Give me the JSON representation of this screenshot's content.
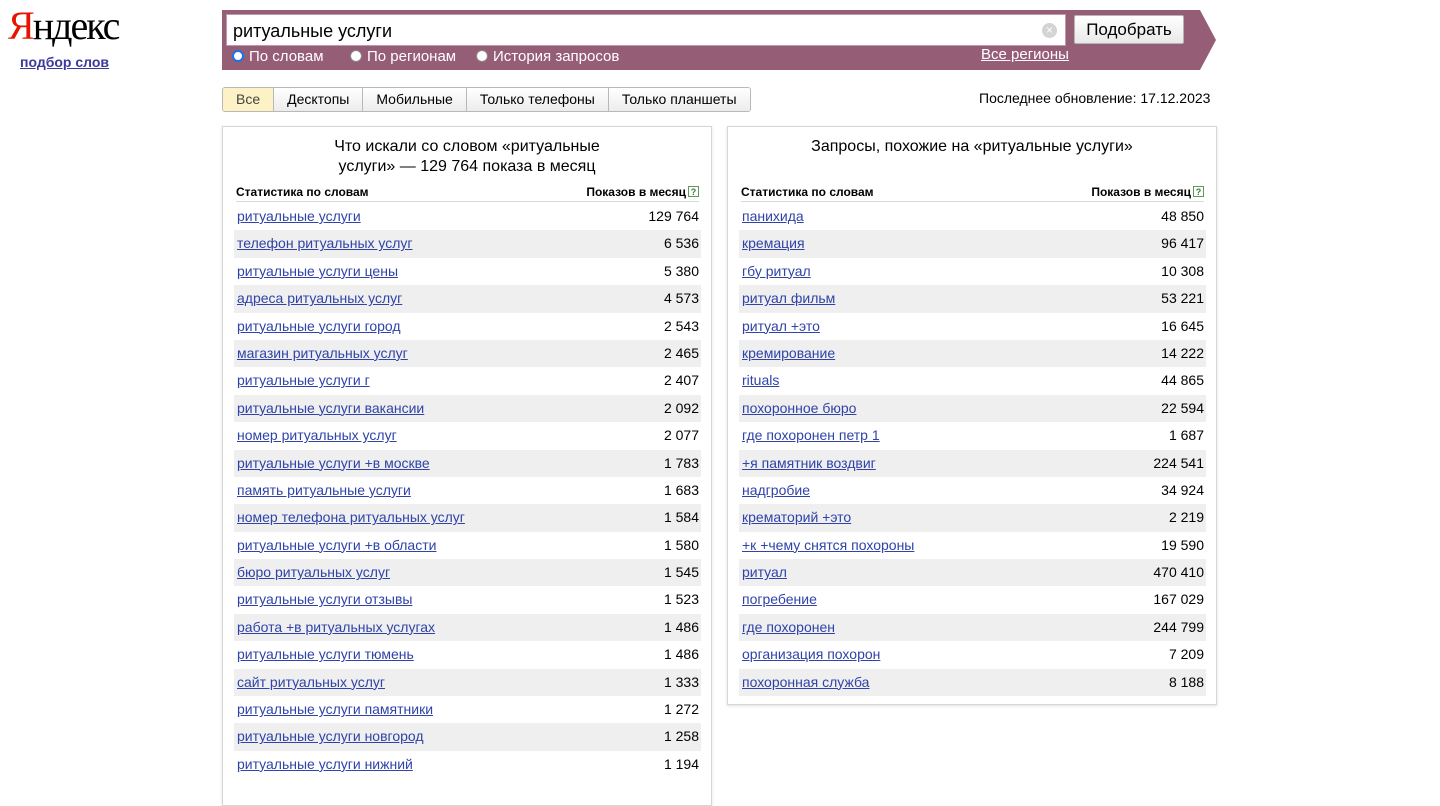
{
  "logo": {
    "first": "Я",
    "rest": "ндекс"
  },
  "sub_link": "подбор слов",
  "search": {
    "query": "ритуальные услуги",
    "button": "Подобрать",
    "modes": [
      "По словам",
      "По регионам",
      "История запросов"
    ],
    "regions_link": "Все регионы"
  },
  "tabs": [
    "Все",
    "Десктопы",
    "Мобильные",
    "Только телефоны",
    "Только планшеты"
  ],
  "updated": "Последнее обновление: 17.12.2023",
  "colors": {
    "bar": "#955d76",
    "link": "#2f43a8",
    "logo_red": "#e61400",
    "active_tab": "#fdf2c5"
  },
  "left": {
    "title_line1": "Что искали со словом «ритуальные",
    "title_line2": "услуги» — 129 764 показа в месяц",
    "col1": "Статистика по словам",
    "col2": "Показов в месяц",
    "rows": [
      {
        "phrase": "ритуальные услуги",
        "count": "129 764"
      },
      {
        "phrase": "телефон ритуальных услуг",
        "count": "6 536"
      },
      {
        "phrase": "ритуальные услуги цены",
        "count": "5 380"
      },
      {
        "phrase": "адреса ритуальных услуг",
        "count": "4 573"
      },
      {
        "phrase": "ритуальные услуги город",
        "count": "2 543"
      },
      {
        "phrase": "магазин ритуальных услуг",
        "count": "2 465"
      },
      {
        "phrase": "ритуальные услуги г",
        "count": "2 407"
      },
      {
        "phrase": "ритуальные услуги вакансии",
        "count": "2 092"
      },
      {
        "phrase": "номер ритуальных услуг",
        "count": "2 077"
      },
      {
        "phrase": "ритуальные услуги +в москве",
        "count": "1 783"
      },
      {
        "phrase": "память ритуальные услуги",
        "count": "1 683"
      },
      {
        "phrase": "номер телефона ритуальных услуг",
        "count": "1 584"
      },
      {
        "phrase": "ритуальные услуги +в области",
        "count": "1 580"
      },
      {
        "phrase": "бюро ритуальных услуг",
        "count": "1 545"
      },
      {
        "phrase": "ритуальные услуги отзывы",
        "count": "1 523"
      },
      {
        "phrase": "работа +в ритуальных услугах",
        "count": "1 486"
      },
      {
        "phrase": "ритуальные услуги тюмень",
        "count": "1 486"
      },
      {
        "phrase": "сайт ритуальных услуг",
        "count": "1 333"
      },
      {
        "phrase": "ритуальные услуги памятники",
        "count": "1 272"
      },
      {
        "phrase": "ритуальные услуги новгород",
        "count": "1 258"
      },
      {
        "phrase": "ритуальные услуги нижний",
        "count": "1 194"
      }
    ]
  },
  "right": {
    "title": "Запросы, похожие на «ритуальные услуги»",
    "col1": "Статистика по словам",
    "col2": "Показов в месяц",
    "rows": [
      {
        "phrase": "панихида",
        "count": "48 850"
      },
      {
        "phrase": "кремация",
        "count": "96 417"
      },
      {
        "phrase": "гбу ритуал",
        "count": "10 308"
      },
      {
        "phrase": "ритуал фильм",
        "count": "53 221"
      },
      {
        "phrase": "ритуал +это",
        "count": "16 645"
      },
      {
        "phrase": "кремирование",
        "count": "14 222"
      },
      {
        "phrase": "rituals",
        "count": "44 865"
      },
      {
        "phrase": "похоронное бюро",
        "count": "22 594"
      },
      {
        "phrase": "где похоронен петр 1",
        "count": "1 687"
      },
      {
        "phrase": "+я памятник воздвиг",
        "count": "224 541"
      },
      {
        "phrase": "надгробие",
        "count": "34 924"
      },
      {
        "phrase": "крематорий +это",
        "count": "2 219"
      },
      {
        "phrase": "+к +чему снятся похороны",
        "count": "19 590"
      },
      {
        "phrase": "ритуал",
        "count": "470 410"
      },
      {
        "phrase": "погребение",
        "count": "167 029"
      },
      {
        "phrase": "где похоронен",
        "count": "244 799"
      },
      {
        "phrase": "организация похорон",
        "count": "7 209"
      },
      {
        "phrase": "похоронная служба",
        "count": "8 188"
      }
    ]
  }
}
